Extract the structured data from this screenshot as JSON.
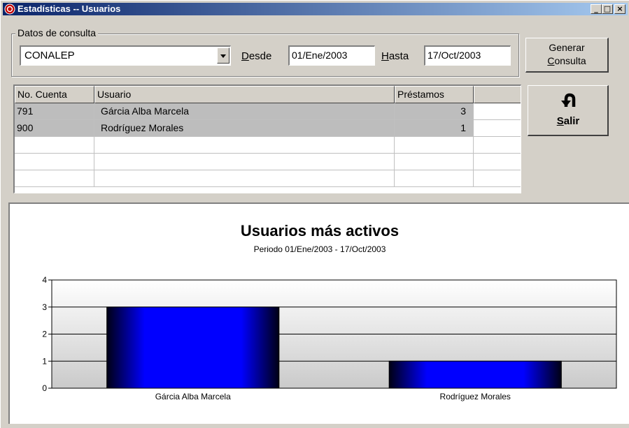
{
  "window": {
    "title": "Estadísticas -- Usuarios",
    "minimize_glyph": "_",
    "maximize_glyph": "□",
    "close_glyph": "×"
  },
  "query": {
    "group_label": "Datos de consulta",
    "institution_value": "CONALEP",
    "desde_label_first": "D",
    "desde_label_rest": "esde",
    "desde_value": "01/Ene/2003",
    "hasta_label_first": "H",
    "hasta_label_rest": "asta",
    "hasta_value": "17/Oct/2003",
    "generate_line1": "Generar",
    "generate_line2_first": "C",
    "generate_line2_rest": "onsulta"
  },
  "exit_button": {
    "label_first": "S",
    "label_rest": "alir",
    "icon": "u-turn-arrow-icon"
  },
  "table": {
    "columns": [
      "No. Cuenta",
      "Usuario",
      "Préstamos",
      ""
    ],
    "rows": [
      {
        "cuenta": "791",
        "usuario": "Gárcia Alba Marcela",
        "prestamos": "3"
      },
      {
        "cuenta": "900",
        "usuario": "Rodríguez Morales",
        "prestamos": "1"
      }
    ]
  },
  "chart_data": {
    "type": "bar",
    "title": "Usuarios más activos",
    "subtitle": "Periodo 01/Ene/2003 - 17/Oct/2003",
    "categories": [
      "Gárcia Alba Marcela",
      "Rodríguez Morales"
    ],
    "values": [
      3,
      1
    ],
    "ylim": [
      0,
      4
    ],
    "yticks": [
      "0",
      "1",
      "2",
      "3",
      "4"
    ],
    "grid": true,
    "bar_color": "#0000ff"
  }
}
